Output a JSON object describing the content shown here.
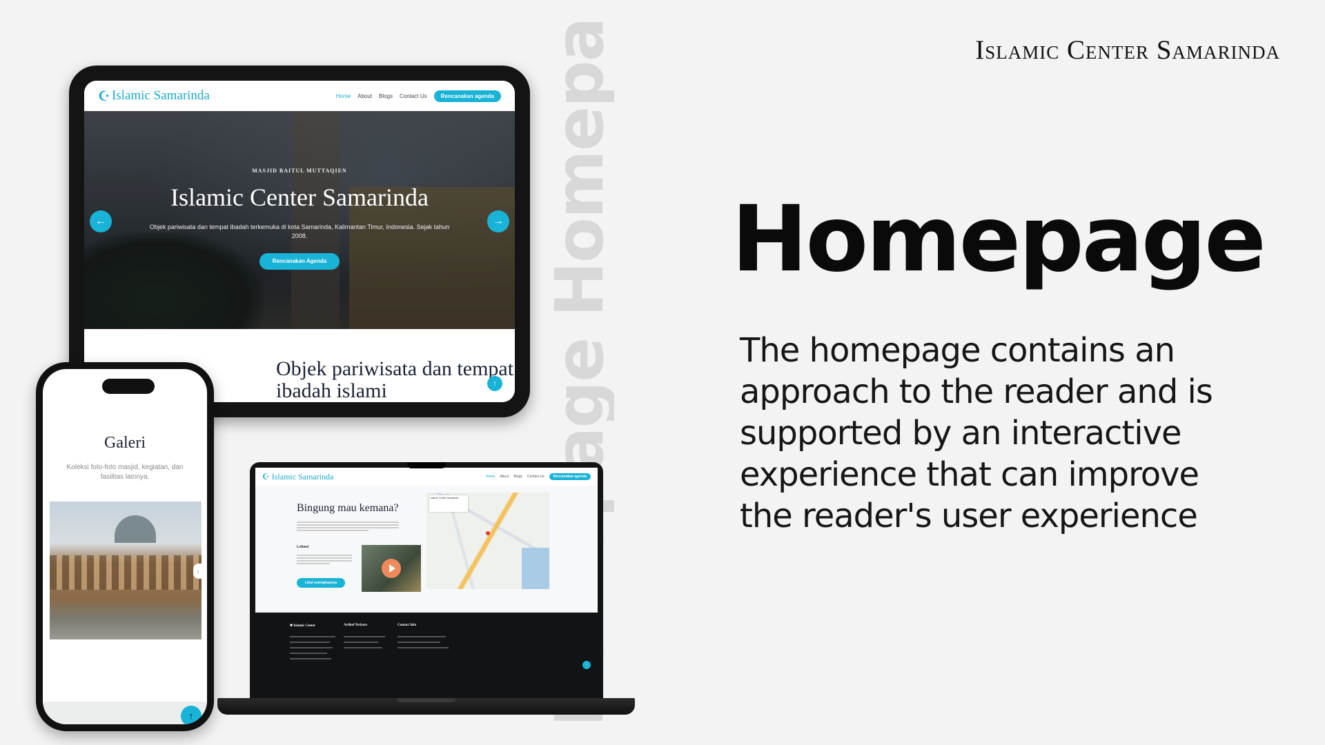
{
  "brand": "Islamic Center Samarinda",
  "watermark": "Homepage Homepa",
  "headline": "Homepage",
  "description": "The homepage contains an approach to the reader and is supported by an interactive experience that can improve the reader's user experience",
  "tablet": {
    "logo": "Islamic Samarinda",
    "nav": [
      "Home",
      "About",
      "Blogs",
      "Contact Us"
    ],
    "nav_cta": "Rencanakan agenda",
    "kicker": "MASJID BAITUL MUTTAQIEN",
    "title": "Islamic Center Samarinda",
    "subtitle": "Objek pariwisata dan tempat ibadah terkemuka di kota Samarinda, Kalimantan Timur, Indonesia. Sejak tahun 2008.",
    "cta": "Rencanakan Agenda",
    "section_title": "Objek pariwisata dan tempat ibadah islami",
    "arrow_left": "←",
    "arrow_right": "→",
    "fab": "↑"
  },
  "laptop": {
    "logo": "Islamic Samarinda",
    "nav": [
      "Home",
      "About",
      "Blogs",
      "Contact Us"
    ],
    "nav_cta": "Rencanakan agenda",
    "title": "Bingung mau kemana?",
    "location_label": "Lokasi",
    "button": "Lihat selengkapnya",
    "map_card": "Islamic Center Samarinda",
    "footer": {
      "col1": "Islamic Center",
      "col2": "Artikel Terbaru",
      "col3": "Contact Info"
    },
    "fab": "↑"
  },
  "phone": {
    "title": "Galeri",
    "subtitle": "Koleksi foto-foto masjid, kegiatan, dan fasilitas lainnya.",
    "next": "›",
    "fab": "↑"
  }
}
